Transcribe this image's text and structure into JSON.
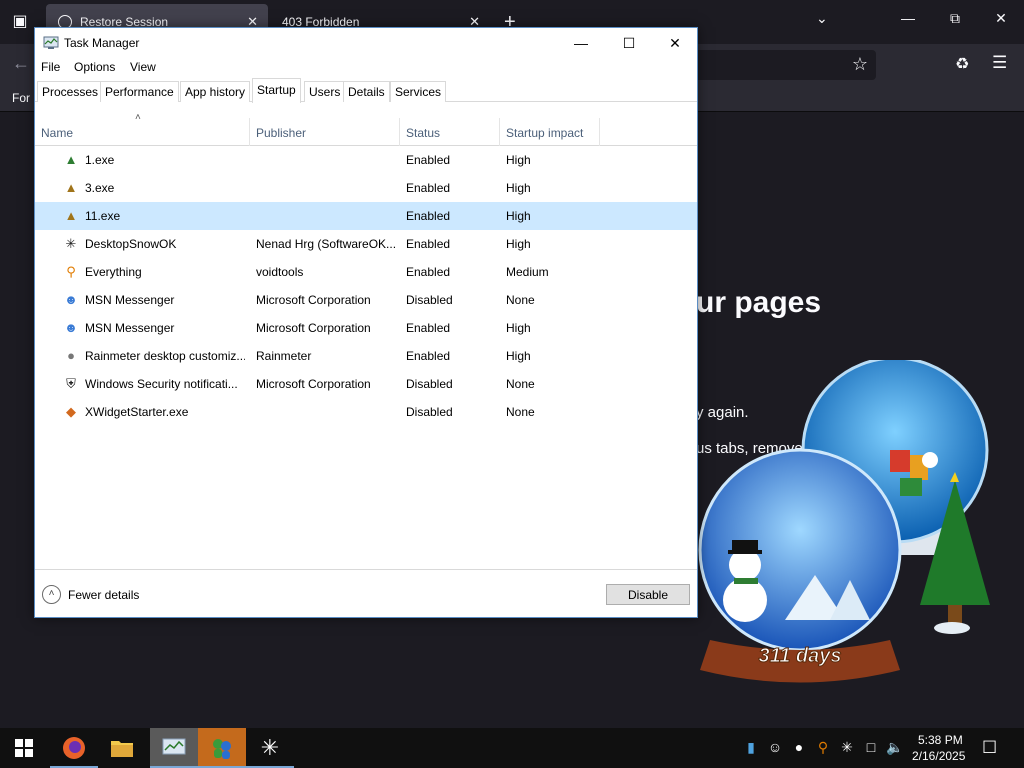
{
  "browser": {
    "tabs": [
      {
        "label": "Restore Session",
        "active": true
      },
      {
        "label": "403 Forbidden",
        "active": false
      }
    ],
    "bookmark_item": "For",
    "page_heading": "ur pages",
    "page_line1": "y again.",
    "page_line2": "us tabs, remove"
  },
  "widget": {
    "counter_text": "311 days"
  },
  "task_manager": {
    "title": "Task Manager",
    "menu": [
      "File",
      "Options",
      "View"
    ],
    "tabs": [
      "Processes",
      "Performance",
      "App history",
      "Startup",
      "Users",
      "Details",
      "Services"
    ],
    "active_tab": "Startup",
    "columns": {
      "name": "Name",
      "publisher": "Publisher",
      "status": "Status",
      "impact": "Startup impact"
    },
    "rows": [
      {
        "name": "1.exe",
        "publisher": "",
        "status": "Enabled",
        "impact": "High",
        "icon": "tree-icon",
        "color": "#2e7d32"
      },
      {
        "name": "3.exe",
        "publisher": "",
        "status": "Enabled",
        "impact": "High",
        "icon": "tree-icon",
        "color": "#a0741a"
      },
      {
        "name": "11.exe",
        "publisher": "",
        "status": "Enabled",
        "impact": "High",
        "icon": "tree-icon",
        "color": "#a0741a",
        "selected": true
      },
      {
        "name": "DesktopSnowOK",
        "publisher": "Nenad Hrg (SoftwareOK....",
        "status": "Enabled",
        "impact": "High",
        "icon": "snowflake-icon",
        "color": "#222222"
      },
      {
        "name": "Everything",
        "publisher": "voidtools",
        "status": "Enabled",
        "impact": "Medium",
        "icon": "magnifier-icon",
        "color": "#e07b00"
      },
      {
        "name": "MSN Messenger",
        "publisher": "Microsoft Corporation",
        "status": "Disabled",
        "impact": "None",
        "icon": "msn-icon",
        "color": "#3a7bd5"
      },
      {
        "name": "MSN Messenger",
        "publisher": "Microsoft Corporation",
        "status": "Enabled",
        "impact": "High",
        "icon": "msn-icon",
        "color": "#3a7bd5"
      },
      {
        "name": "Rainmeter desktop customiz...",
        "publisher": "Rainmeter",
        "status": "Enabled",
        "impact": "High",
        "icon": "drop-icon",
        "color": "#777777"
      },
      {
        "name": "Windows Security notificati...",
        "publisher": "Microsoft Corporation",
        "status": "Disabled",
        "impact": "None",
        "icon": "shield-icon",
        "color": "#222222"
      },
      {
        "name": "XWidgetStarter.exe",
        "publisher": "",
        "status": "Disabled",
        "impact": "None",
        "icon": "xwidget-icon",
        "color": "#d2691e"
      }
    ],
    "footer": {
      "fewer_details": "Fewer details",
      "disable_button": "Disable"
    }
  },
  "taskbar": {
    "time": "5:38 PM",
    "date": "2/16/2025"
  },
  "colors": {
    "selection": "#cce8ff",
    "browser_bg": "#1c1b22",
    "taskbar_bg": "#101010"
  }
}
